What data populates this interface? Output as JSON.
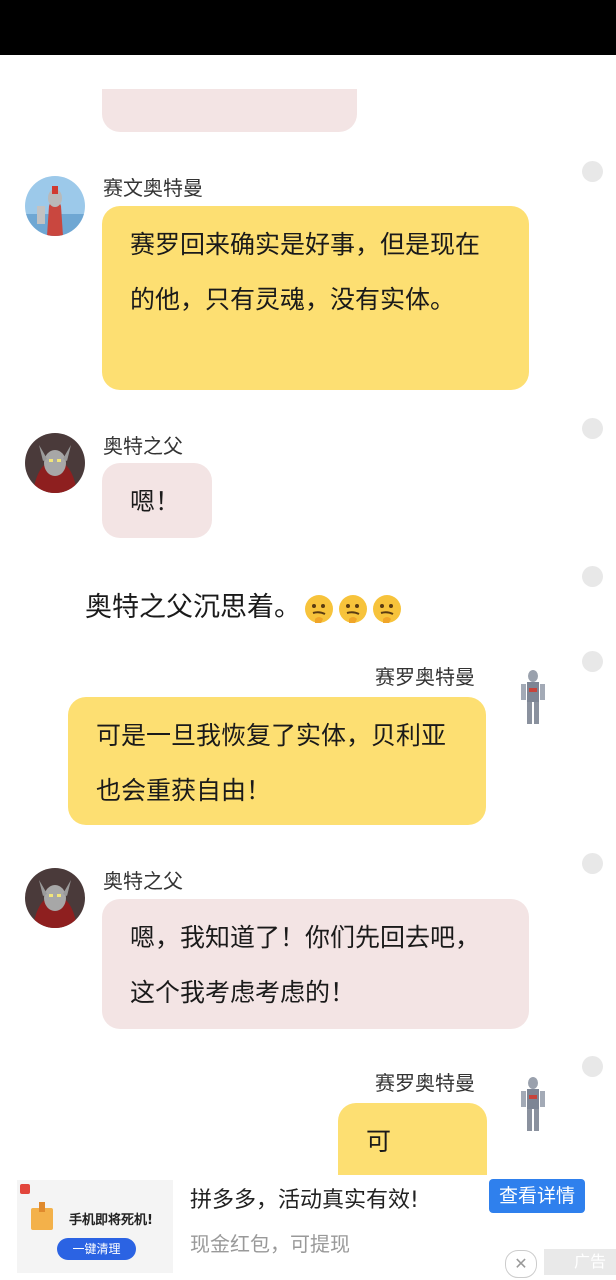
{
  "messages": [
    {
      "sender": "赛文奥特曼",
      "text": "赛罗回来确实是好事，但是现在的他，只有灵魂，没有实体。"
    },
    {
      "sender": "奥特之父",
      "text": "嗯！"
    },
    {
      "narration": "奥特之父沉思着。"
    },
    {
      "sender": "赛罗奥特曼",
      "text": "可是一旦我恢复了实体，贝利亚也会重获自由！"
    },
    {
      "sender": "奥特之父",
      "text": "嗯，我知道了！你们先回去吧，这个我考虑考虑的！"
    },
    {
      "sender": "赛罗奥特曼",
      "text": "可是……"
    }
  ],
  "emoji": [
    "thinking-face-icon",
    "thinking-face-icon",
    "thinking-face-icon"
  ],
  "ad": {
    "thumb_headline": "手机即将死机!",
    "thumb_button": "一键清理",
    "title": "拼多多，活动真实有效!",
    "subtitle": "现金红包，可提现",
    "cta": "查看详情",
    "close_symbol": "✕",
    "tag": "广告"
  },
  "colors": {
    "pink_bubble": "#f3e4e4",
    "yellow_bubble": "#fddf72",
    "cta_blue": "#2f80ed"
  }
}
